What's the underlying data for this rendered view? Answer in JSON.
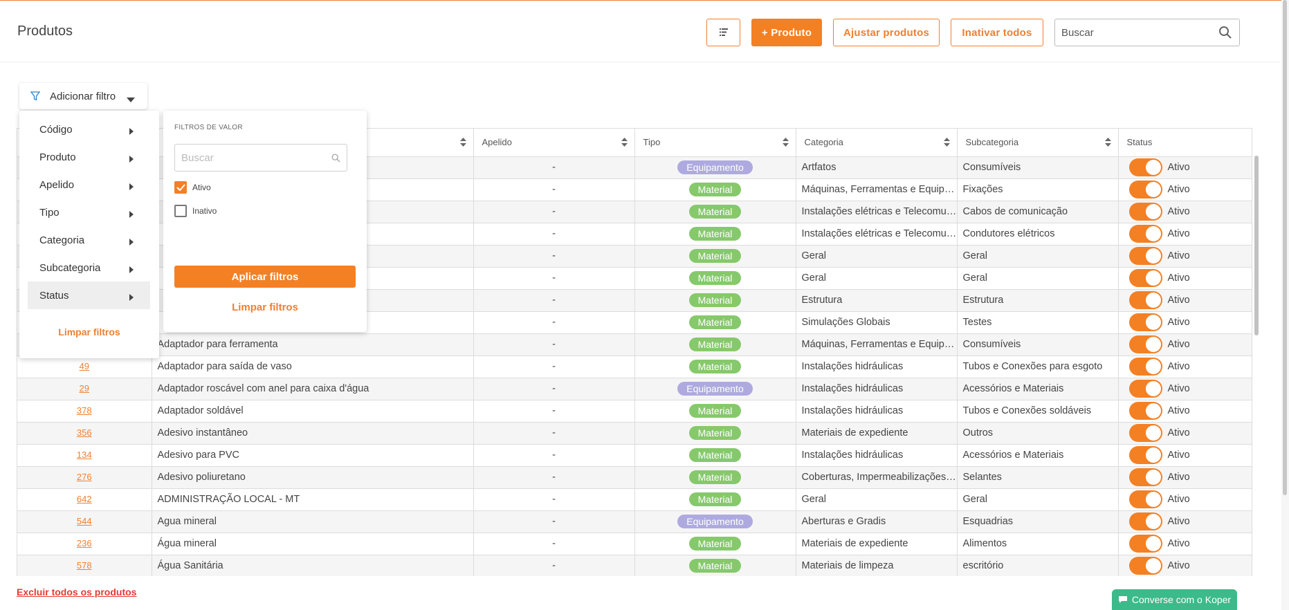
{
  "header": {
    "title": "Produtos",
    "sort_icon": "list-sort-icon",
    "add_label": "+ Produto",
    "adjust_label": "Ajustar produtos",
    "inactivate_label": "Inativar todos",
    "search_placeholder": "Buscar"
  },
  "filter": {
    "button_label": "Adicionar filtro",
    "menu_items": [
      {
        "label": "Código"
      },
      {
        "label": "Produto"
      },
      {
        "label": "Apelido"
      },
      {
        "label": "Tipo"
      },
      {
        "label": "Categoria"
      },
      {
        "label": "Subcategoria"
      },
      {
        "label": "Status"
      }
    ],
    "active_item": "Status",
    "menu_clear_label": "Limpar filtros",
    "panel": {
      "title": "FILTROS DE VALOR",
      "search_placeholder": "Buscar",
      "options": [
        {
          "label": "Ativo",
          "checked": true
        },
        {
          "label": "Inativo",
          "checked": false
        }
      ],
      "apply_label": "Aplicar filtros",
      "clear_label": "Limpar filtros"
    }
  },
  "table": {
    "columns": [
      "",
      "",
      "Apelido",
      "Tipo",
      "Categoria",
      "Subcategoria",
      "Status"
    ],
    "rows": [
      {
        "code": "",
        "product": "",
        "apelido": "-",
        "tipo": "Equipamento",
        "categoria": "Artfatos",
        "subcategoria": "Consumíveis",
        "status": "Ativo"
      },
      {
        "code": "",
        "product": "",
        "apelido": "-",
        "tipo": "Material",
        "categoria": "Máquinas, Ferramentas e Equipamentos",
        "subcategoria": "Fixações",
        "status": "Ativo"
      },
      {
        "code": "",
        "product": "",
        "apelido": "-",
        "tipo": "Material",
        "categoria": "Instalações elétricas e Telecomunicações",
        "subcategoria": "Cabos de comunicação",
        "status": "Ativo"
      },
      {
        "code": "",
        "product": "",
        "apelido": "-",
        "tipo": "Material",
        "categoria": "Instalações elétricas e Telecomunicações",
        "subcategoria": "Condutores elétricos",
        "status": "Ativo"
      },
      {
        "code": "",
        "product": "",
        "apelido": "-",
        "tipo": "Material",
        "categoria": "Geral",
        "subcategoria": "Geral",
        "status": "Ativo"
      },
      {
        "code": "",
        "product": "",
        "apelido": "-",
        "tipo": "Material",
        "categoria": "Geral",
        "subcategoria": "Geral",
        "status": "Ativo"
      },
      {
        "code": "",
        "product": "",
        "apelido": "-",
        "tipo": "Material",
        "categoria": "Estrutura",
        "subcategoria": "Estrutura",
        "status": "Ativo"
      },
      {
        "code": "",
        "product": "",
        "apelido": "-",
        "tipo": "Material",
        "categoria": "Simulações Globais",
        "subcategoria": "Testes",
        "status": "Ativo"
      },
      {
        "code": "",
        "product": "Adaptador para ferramenta",
        "apelido": "-",
        "tipo": "Material",
        "categoria": "Máquinas, Ferramentas e Equipamentos",
        "subcategoria": "Consumíveis",
        "status": "Ativo"
      },
      {
        "code": "49",
        "product": "Adaptador para saída de vaso",
        "apelido": "-",
        "tipo": "Material",
        "categoria": "Instalações hidráulicas",
        "subcategoria": "Tubos e Conexões para esgoto",
        "status": "Ativo"
      },
      {
        "code": "29",
        "product": "Adaptador roscável com anel para caixa d'água",
        "apelido": "-",
        "tipo": "Equipamento",
        "categoria": "Instalações hidráulicas",
        "subcategoria": "Acessórios e Materiais",
        "status": "Ativo"
      },
      {
        "code": "378",
        "product": "Adaptador soldável",
        "apelido": "-",
        "tipo": "Material",
        "categoria": "Instalações hidráulicas",
        "subcategoria": "Tubos e Conexões soldáveis",
        "status": "Ativo"
      },
      {
        "code": "356",
        "product": "Adesivo instantâneo",
        "apelido": "-",
        "tipo": "Material",
        "categoria": "Materiais de expediente",
        "subcategoria": "Outros",
        "status": "Ativo"
      },
      {
        "code": "134",
        "product": "Adesivo para PVC",
        "apelido": "-",
        "tipo": "Material",
        "categoria": "Instalações hidráulicas",
        "subcategoria": "Acessórios e Materiais",
        "status": "Ativo"
      },
      {
        "code": "276",
        "product": "Adesivo poliuretano",
        "apelido": "-",
        "tipo": "Material",
        "categoria": "Coberturas, Impermeabilizações e Isolamentos",
        "subcategoria": "Selantes",
        "status": "Ativo"
      },
      {
        "code": "642",
        "product": "ADMINISTRAÇÃO LOCAL - MT",
        "apelido": "-",
        "tipo": "Material",
        "categoria": "Geral",
        "subcategoria": "Geral",
        "status": "Ativo"
      },
      {
        "code": "544",
        "product": "Agua mineral",
        "apelido": "-",
        "tipo": "Equipamento",
        "categoria": "Aberturas e Gradis",
        "subcategoria": "Esquadrias",
        "status": "Ativo"
      },
      {
        "code": "236",
        "product": "Água mineral",
        "apelido": "-",
        "tipo": "Material",
        "categoria": "Materiais de expediente",
        "subcategoria": "Alimentos",
        "status": "Ativo"
      },
      {
        "code": "578",
        "product": "Água Sanitária",
        "apelido": "-",
        "tipo": "Material",
        "categoria": "Materiais de limpeza",
        "subcategoria": "escritório",
        "status": "Ativo"
      }
    ]
  },
  "footer": {
    "delete_all_label": "Excluir todos os produtos",
    "chat_label": "Converse com o Koper"
  },
  "colors": {
    "accent": "#f48024",
    "material": "#86c96b",
    "equipamento": "#aeaae0",
    "danger": "#e53935",
    "chat": "#3dba8a"
  }
}
